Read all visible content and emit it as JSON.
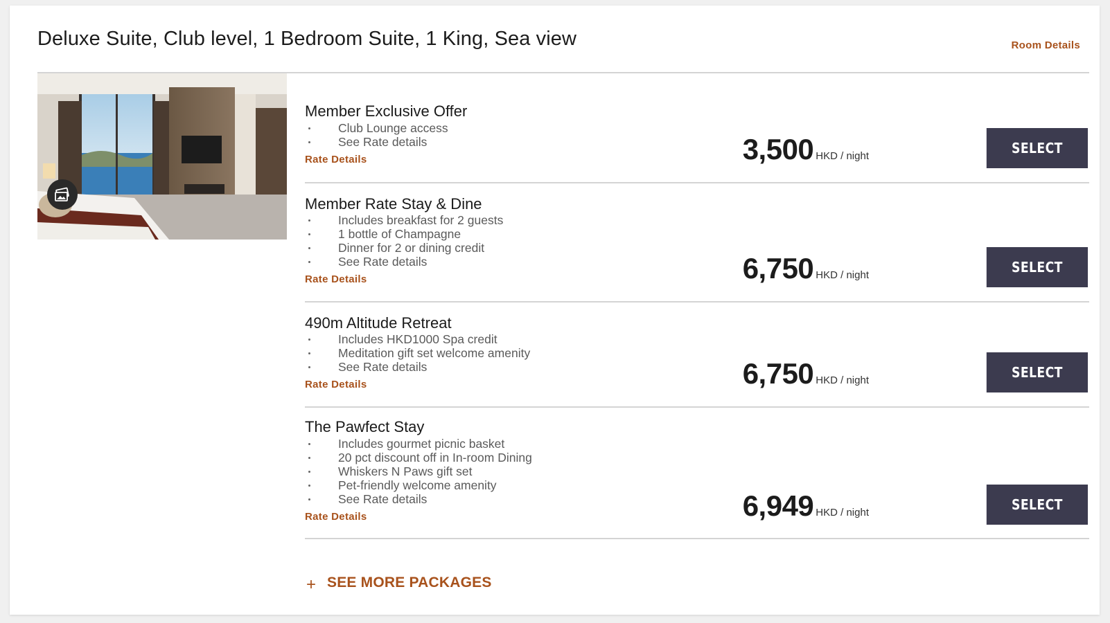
{
  "room": {
    "title": "Deluxe Suite, Club level, 1 Bedroom Suite, 1 King, Sea view",
    "details_link": "Room Details",
    "image_icon": "gallery-icon"
  },
  "rates": [
    {
      "name": "Member Exclusive Offer",
      "perks": [
        "Club Lounge access",
        "See Rate details"
      ],
      "details_link": "Rate Details",
      "price": "3,500",
      "unit": "HKD / night",
      "button": "SELECT"
    },
    {
      "name": "Member Rate Stay & Dine",
      "perks": [
        "Includes breakfast for 2 guests",
        "1 bottle of Champagne",
        "Dinner for 2 or dining credit",
        "See Rate details"
      ],
      "details_link": "Rate Details",
      "price": "6,750",
      "unit": "HKD / night",
      "button": "SELECT"
    },
    {
      "name": "490m Altitude Retreat",
      "perks": [
        "Includes HKD1000 Spa credit",
        "Meditation gift set welcome amenity",
        "See Rate details"
      ],
      "details_link": "Rate Details",
      "price": "6,750",
      "unit": "HKD / night",
      "button": "SELECT"
    },
    {
      "name": "The Pawfect Stay",
      "perks": [
        "Includes gourmet picnic basket",
        "20 pct discount off in In-room Dining",
        "Whiskers N Paws gift set",
        "Pet-friendly welcome amenity",
        "See Rate details"
      ],
      "details_link": "Rate Details",
      "price": "6,949",
      "unit": "HKD / night",
      "button": "SELECT"
    }
  ],
  "see_more": {
    "icon": "plus-icon",
    "symbol": "+",
    "label": "SEE MORE PACKAGES"
  },
  "colors": {
    "accent": "#a8521c",
    "button_bg": "#3c3b4f",
    "divider": "#d4d4d4"
  }
}
